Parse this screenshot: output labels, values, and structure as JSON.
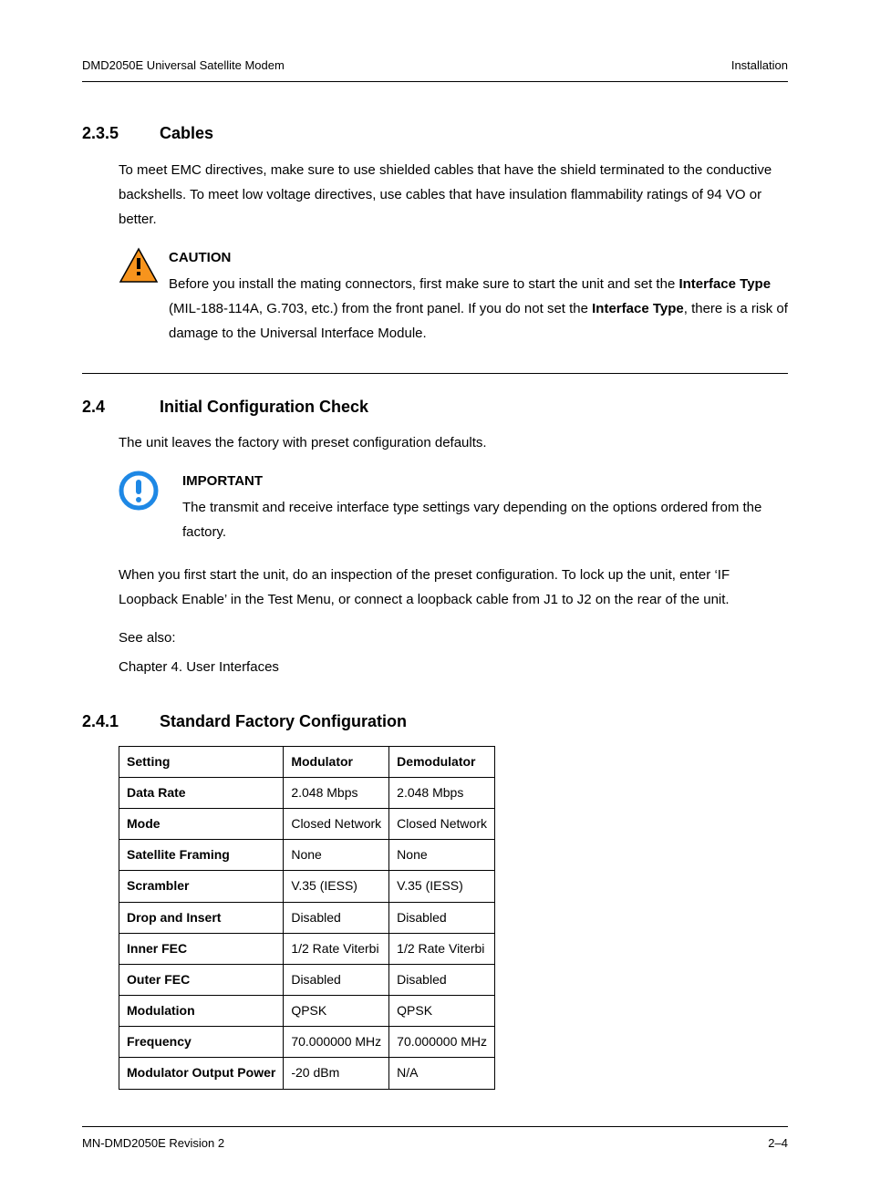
{
  "header": {
    "left": "DMD2050E Universal Satellite Modem",
    "right": "Installation"
  },
  "s235": {
    "num": "2.3.5",
    "title": "Cables",
    "p1": "To meet EMC directives, make sure to use shielded cables that have the shield terminated to the conductive backshells.  To meet low voltage directives, use cables that have insulation flammability ratings of 94 VO or better.",
    "caution": {
      "title": "CAUTION",
      "line1a": "Before you install the mating connectors, first make sure to start the unit and set the ",
      "bold1": "Interface Type",
      "line1b": "  (MIL-188-114A, G.703, etc.) from the front panel.  If you do not set the ",
      "bold2": "Interface Type",
      "line1c": ", there is a risk of damage to the Universal Interface Module."
    }
  },
  "s24": {
    "num": "2.4",
    "title": "Initial Configuration Check",
    "p1": "The unit leaves the factory with preset configuration defaults.",
    "important": {
      "title": "IMPORTANT",
      "body": "The transmit and receive interface type settings vary depending on the options ordered from the factory."
    },
    "p2": "When you first start the unit, do an inspection of the preset configuration.  To lock up the unit, enter ‘IF Loopback Enable’ in the Test Menu, or connect a loopback cable from J1 to J2 on the rear of the unit.",
    "see_also_label": "See also:",
    "see_also_ref": "Chapter 4. User Interfaces"
  },
  "s241": {
    "num": "2.4.1",
    "title": "Standard Factory Configuration",
    "headers": {
      "c1": "Setting",
      "c2": "Modulator",
      "c3": "Demodulator"
    },
    "rows": [
      {
        "setting": "Data Rate",
        "mod": "2.048 Mbps",
        "demod": "2.048 Mbps"
      },
      {
        "setting": "Mode",
        "mod": "Closed Network",
        "demod": "Closed Network"
      },
      {
        "setting": "Satellite Framing",
        "mod": "None",
        "demod": "None"
      },
      {
        "setting": "Scrambler",
        "mod": "V.35 (IESS)",
        "demod": "V.35 (IESS)"
      },
      {
        "setting": "Drop and Insert",
        "mod": "Disabled",
        "demod": "Disabled"
      },
      {
        "setting": "Inner FEC",
        "mod": "1/2 Rate Viterbi",
        "demod": "1/2 Rate Viterbi"
      },
      {
        "setting": "Outer FEC",
        "mod": "Disabled",
        "demod": "Disabled"
      },
      {
        "setting": "Modulation",
        "mod": "QPSK",
        "demod": "QPSK"
      },
      {
        "setting": "Frequency",
        "mod": "70.000000 MHz",
        "demod": "70.000000 MHz"
      },
      {
        "setting": "Modulator Output Power",
        "mod": "-20 dBm",
        "demod": "N/A"
      }
    ]
  },
  "footer": {
    "left": "MN-DMD2050E   Revision 2",
    "right": "2–4"
  }
}
